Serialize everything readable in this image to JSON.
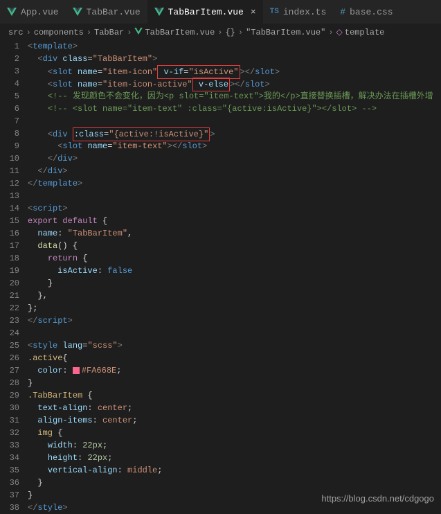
{
  "tabs": [
    {
      "label": "App.vue",
      "icon": "vue"
    },
    {
      "label": "TabBar.vue",
      "icon": "vue"
    },
    {
      "label": "TabBarItem.vue",
      "icon": "vue",
      "active": true
    },
    {
      "label": "index.ts",
      "icon": "ts"
    },
    {
      "label": "base.css",
      "icon": "css"
    }
  ],
  "breadcrumb": {
    "items": [
      "src",
      "components",
      "TabBar",
      "TabBarItem.vue",
      "{}",
      "\"TabBarItem.vue\"",
      "template"
    ]
  },
  "code": {
    "lines": [
      {
        "n": 1,
        "segs": [
          {
            "t": "<",
            "c": "tag-open"
          },
          {
            "t": "template",
            "c": "tag-name"
          },
          {
            "t": ">",
            "c": "tag-open"
          }
        ]
      },
      {
        "n": 2,
        "indent": 2,
        "segs": [
          {
            "t": "<",
            "c": "tag-open"
          },
          {
            "t": "div",
            "c": "tag-name"
          },
          {
            "t": " "
          },
          {
            "t": "class",
            "c": "attr-name"
          },
          {
            "t": "="
          },
          {
            "t": "\"TabBarItem\"",
            "c": "attr-val"
          },
          {
            "t": ">",
            "c": "tag-open"
          }
        ]
      },
      {
        "n": 3,
        "indent": 4,
        "segs": [
          {
            "t": "<",
            "c": "tag-open"
          },
          {
            "t": "slot",
            "c": "tag-name"
          },
          {
            "t": " "
          },
          {
            "t": "name",
            "c": "attr-name"
          },
          {
            "t": "="
          },
          {
            "t": "\"item-icon\"",
            "c": "attr-val"
          },
          {
            "box": true,
            "segs": [
              {
                "t": " "
              },
              {
                "t": "v-if",
                "c": "attr-name"
              },
              {
                "t": "="
              },
              {
                "t": "\"isActive\"",
                "c": "attr-val"
              }
            ]
          },
          {
            "t": "></",
            "c": "tag-open"
          },
          {
            "t": "slot",
            "c": "tag-name"
          },
          {
            "t": ">",
            "c": "tag-open"
          }
        ]
      },
      {
        "n": 4,
        "indent": 4,
        "segs": [
          {
            "t": "<",
            "c": "tag-open"
          },
          {
            "t": "slot",
            "c": "tag-name"
          },
          {
            "t": " "
          },
          {
            "t": "name",
            "c": "attr-name"
          },
          {
            "t": "="
          },
          {
            "t": "\"item-icon-active\"",
            "c": "attr-val"
          },
          {
            "box": true,
            "segs": [
              {
                "t": " "
              },
              {
                "t": "v-else",
                "c": "attr-name"
              }
            ]
          },
          {
            "t": "></",
            "c": "tag-open"
          },
          {
            "t": "slot",
            "c": "tag-name"
          },
          {
            "t": ">",
            "c": "tag-open"
          }
        ]
      },
      {
        "n": 5,
        "indent": 4,
        "segs": [
          {
            "t": "<!-- 发现颜色不会变化，因为<p slot=\"item-text\">我的</p>直接替换插槽，解决办法在插槽外增",
            "c": "comment"
          }
        ]
      },
      {
        "n": 6,
        "indent": 4,
        "segs": [
          {
            "t": "<!-- <slot name=\"item-text\" :class=\"{active:isActive}\"></slot> -->",
            "c": "comment"
          }
        ]
      },
      {
        "n": 7,
        "segs": []
      },
      {
        "n": 8,
        "indent": 4,
        "segs": [
          {
            "t": "<",
            "c": "tag-open"
          },
          {
            "t": "div",
            "c": "tag-name"
          },
          {
            "t": " "
          },
          {
            "box": true,
            "segs": [
              {
                "t": ":class",
                "c": "attr-name"
              },
              {
                "t": "="
              },
              {
                "t": "\"{active:!isActive}\"",
                "c": "attr-val"
              }
            ]
          },
          {
            "t": ">",
            "c": "tag-open"
          }
        ]
      },
      {
        "n": 9,
        "indent": 6,
        "segs": [
          {
            "t": "<",
            "c": "tag-open"
          },
          {
            "t": "slot",
            "c": "tag-name"
          },
          {
            "t": " "
          },
          {
            "t": "name",
            "c": "attr-name"
          },
          {
            "t": "="
          },
          {
            "t": "\"item-text\"",
            "c": "attr-val"
          },
          {
            "t": "></",
            "c": "tag-open"
          },
          {
            "t": "slot",
            "c": "tag-name"
          },
          {
            "t": ">",
            "c": "tag-open"
          }
        ]
      },
      {
        "n": 10,
        "indent": 4,
        "segs": [
          {
            "t": "</",
            "c": "tag-open"
          },
          {
            "t": "div",
            "c": "tag-name"
          },
          {
            "t": ">",
            "c": "tag-open"
          }
        ]
      },
      {
        "n": 11,
        "indent": 2,
        "segs": [
          {
            "t": "</",
            "c": "tag-open"
          },
          {
            "t": "div",
            "c": "tag-name"
          },
          {
            "t": ">",
            "c": "tag-open"
          }
        ]
      },
      {
        "n": 12,
        "segs": [
          {
            "t": "</",
            "c": "tag-open"
          },
          {
            "t": "template",
            "c": "tag-name"
          },
          {
            "t": ">",
            "c": "tag-open"
          }
        ]
      },
      {
        "n": 13,
        "segs": []
      },
      {
        "n": 14,
        "segs": [
          {
            "t": "<",
            "c": "tag-open"
          },
          {
            "t": "script",
            "c": "tag-name"
          },
          {
            "t": ">",
            "c": "tag-open"
          }
        ]
      },
      {
        "n": 15,
        "segs": [
          {
            "t": "export default",
            "c": "export-kw"
          },
          {
            "t": " {"
          }
        ]
      },
      {
        "n": 16,
        "indent": 2,
        "segs": [
          {
            "t": "name",
            "c": "prop-name"
          },
          {
            "t": ": "
          },
          {
            "t": "\"TabBarItem\"",
            "c": "string"
          },
          {
            "t": ","
          }
        ]
      },
      {
        "n": 17,
        "indent": 2,
        "segs": [
          {
            "t": "data",
            "c": "func"
          },
          {
            "t": "() {"
          }
        ]
      },
      {
        "n": 18,
        "indent": 4,
        "segs": [
          {
            "t": "return",
            "c": "keyword"
          },
          {
            "t": " {"
          }
        ]
      },
      {
        "n": 19,
        "indent": 6,
        "segs": [
          {
            "t": "isActive",
            "c": "prop-name"
          },
          {
            "t": ": "
          },
          {
            "t": "false",
            "c": "bool"
          }
        ]
      },
      {
        "n": 20,
        "indent": 4,
        "segs": [
          {
            "t": "}"
          }
        ]
      },
      {
        "n": 21,
        "indent": 2,
        "segs": [
          {
            "t": "},"
          }
        ]
      },
      {
        "n": 22,
        "segs": [
          {
            "t": "};"
          }
        ]
      },
      {
        "n": 23,
        "segs": [
          {
            "t": "</",
            "c": "tag-open"
          },
          {
            "t": "script",
            "c": "tag-name"
          },
          {
            "t": ">",
            "c": "tag-open"
          }
        ]
      },
      {
        "n": 24,
        "segs": []
      },
      {
        "n": 25,
        "segs": [
          {
            "t": "<",
            "c": "tag-open"
          },
          {
            "t": "style",
            "c": "tag-name"
          },
          {
            "t": " "
          },
          {
            "t": "lang",
            "c": "attr-name"
          },
          {
            "t": "="
          },
          {
            "t": "\"scss\"",
            "c": "attr-val"
          },
          {
            "t": ">",
            "c": "tag-open"
          }
        ]
      },
      {
        "n": 26,
        "segs": [
          {
            "t": ".active",
            "c": "selector"
          },
          {
            "t": "{"
          }
        ]
      },
      {
        "n": 27,
        "indent": 2,
        "segs": [
          {
            "t": "color",
            "c": "css-prop"
          },
          {
            "t": ": "
          },
          {
            "swatch": true
          },
          {
            "t": "#FA668E",
            "c": "css-val"
          },
          {
            "t": ";"
          }
        ]
      },
      {
        "n": 28,
        "segs": [
          {
            "t": "}"
          }
        ]
      },
      {
        "n": 29,
        "segs": [
          {
            "t": ".TabBarItem",
            "c": "selector"
          },
          {
            "t": " {"
          }
        ]
      },
      {
        "n": 30,
        "indent": 2,
        "segs": [
          {
            "t": "text-align",
            "c": "css-prop"
          },
          {
            "t": ": "
          },
          {
            "t": "center",
            "c": "css-val"
          },
          {
            "t": ";"
          }
        ]
      },
      {
        "n": 31,
        "indent": 2,
        "segs": [
          {
            "t": "align-items",
            "c": "css-prop"
          },
          {
            "t": ": "
          },
          {
            "t": "center",
            "c": "css-val"
          },
          {
            "t": ";"
          }
        ]
      },
      {
        "n": 32,
        "indent": 2,
        "segs": [
          {
            "t": "img",
            "c": "selector"
          },
          {
            "t": " {"
          }
        ]
      },
      {
        "n": 33,
        "indent": 4,
        "segs": [
          {
            "t": "width",
            "c": "css-prop"
          },
          {
            "t": ": "
          },
          {
            "t": "22px",
            "c": "css-num"
          },
          {
            "t": ";"
          }
        ]
      },
      {
        "n": 34,
        "indent": 4,
        "segs": [
          {
            "t": "height",
            "c": "css-prop"
          },
          {
            "t": ": "
          },
          {
            "t": "22px",
            "c": "css-num"
          },
          {
            "t": ";"
          }
        ]
      },
      {
        "n": 35,
        "indent": 4,
        "segs": [
          {
            "t": "vertical-align",
            "c": "css-prop"
          },
          {
            "t": ": "
          },
          {
            "t": "middle",
            "c": "css-val"
          },
          {
            "t": ";"
          }
        ]
      },
      {
        "n": 36,
        "indent": 2,
        "segs": [
          {
            "t": "}"
          }
        ]
      },
      {
        "n": 37,
        "segs": [
          {
            "t": "}"
          }
        ]
      },
      {
        "n": 38,
        "segs": [
          {
            "t": "</",
            "c": "tag-open"
          },
          {
            "t": "style",
            "c": "tag-name"
          },
          {
            "t": ">",
            "c": "tag-open"
          }
        ]
      }
    ]
  },
  "watermark": "https://blog.csdn.net/cdgogo"
}
